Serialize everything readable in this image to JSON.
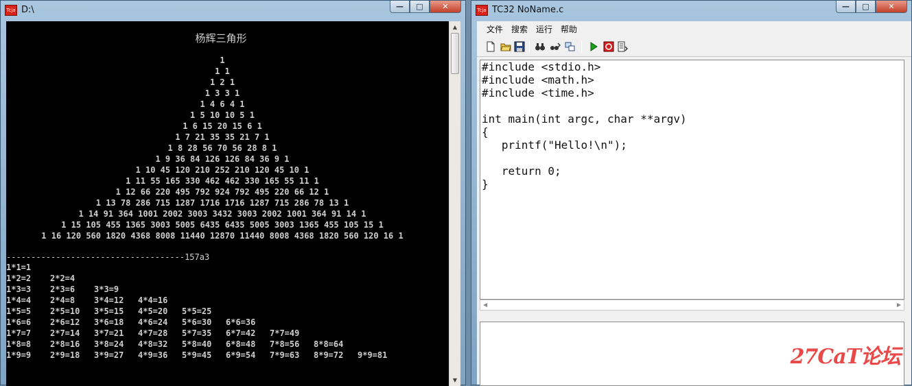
{
  "console_window": {
    "title": "D:\\",
    "icon": "tc-app-icon",
    "caption": "杨辉三角形",
    "pascal_rows": [
      "1",
      "1 1",
      "1 2 1",
      "1 3 3 1",
      "1 4 6 4 1",
      "1 5 10 10 5 1",
      "1 6 15 20 15 6 1",
      "1 7 21 35 35 21 7 1",
      "1 8 28 56 70 56 28 8 1",
      "1 9 36 84 126 126 84 36 9 1",
      "1 10 45 120 210 252 210 120 45 10 1",
      "1 11 55 165 330 462 462 330 165 55 11 1",
      "1 12 66 220 495 792 924 792 495 220 66 12 1",
      "1 13 78 286 715 1287 1716 1716 1287 715 286 78 13 1",
      "1 14 91 364 1001 2002 3003 3432 3003 2002 1001 364 91 14 1",
      "1 15 105 455 1365 3003 5005 6435 6435 5005 3003 1365 455 105 15 1",
      "1 16 120 560 1820 4368 8008 11440 12870 11440 8008 4368 1820 560 120 16 1"
    ],
    "separator": "------------------------------------157a3",
    "multiplication_table": [
      [
        "1*1=1"
      ],
      [
        "1*2=2",
        "2*2=4"
      ],
      [
        "1*3=3",
        "2*3=6",
        "3*3=9"
      ],
      [
        "1*4=4",
        "2*4=8",
        "3*4=12",
        "4*4=16"
      ],
      [
        "1*5=5",
        "2*5=10",
        "3*5=15",
        "4*5=20",
        "5*5=25"
      ],
      [
        "1*6=6",
        "2*6=12",
        "3*6=18",
        "4*6=24",
        "5*6=30",
        "6*6=36"
      ],
      [
        "1*7=7",
        "2*7=14",
        "3*7=21",
        "4*7=28",
        "5*7=35",
        "6*7=42",
        "7*7=49"
      ],
      [
        "1*8=8",
        "2*8=16",
        "3*8=24",
        "4*8=32",
        "5*8=40",
        "6*8=48",
        "7*8=56",
        "8*8=64"
      ],
      [
        "1*9=9",
        "2*9=18",
        "3*9=27",
        "4*9=36",
        "5*9=45",
        "6*9=54",
        "7*9=63",
        "8*9=72",
        "9*9=81"
      ]
    ],
    "controls": {
      "minimize": "—",
      "maximize": "□",
      "close": "✕"
    }
  },
  "editor_window": {
    "title": "TC32 NoName.c",
    "icon": "tc-app-icon",
    "menu": [
      "文件",
      "搜索",
      "运行",
      "帮助"
    ],
    "toolbar": [
      "new-file-icon",
      "open-folder-icon",
      "save-icon",
      "find-icon",
      "find-next-icon",
      "replace-icon",
      "run-icon",
      "stop-icon",
      "compile-icon"
    ],
    "code_lines": [
      "#include <stdio.h>",
      "#include <math.h>",
      "#include <time.h>",
      "",
      "int main(int argc, char **argv)",
      "{",
      "   printf(\"Hello!\\n\");",
      "",
      "   return 0;",
      "}"
    ],
    "controls": {
      "minimize": "—",
      "maximize": "□",
      "close": "✕"
    }
  },
  "watermark": "27CaT论坛"
}
